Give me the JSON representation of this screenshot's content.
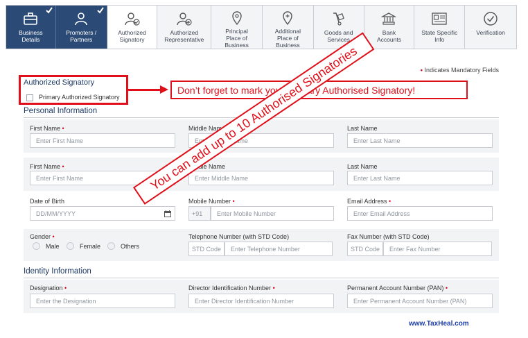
{
  "tabs": [
    {
      "label1": "Business",
      "label2": "Details",
      "icon": "briefcase-icon",
      "state": "done"
    },
    {
      "label1": "Promoters /",
      "label2": "Partners",
      "icon": "person-icon",
      "state": "done"
    },
    {
      "label1": "Authorized",
      "label2": "Signatory",
      "icon": "person-check-icon",
      "state": "active"
    },
    {
      "label1": "Authorized",
      "label2": "Representative",
      "icon": "person-plus-icon",
      "state": "todo"
    },
    {
      "label1": "Principal",
      "label2": "Place of",
      "label3": "Business",
      "icon": "location-pin-icon",
      "state": "todo"
    },
    {
      "label1": "Additional",
      "label2": "Place of",
      "label3": "Business",
      "icon": "location-plus-icon",
      "state": "todo"
    },
    {
      "label1": "Goods and",
      "label2": "Services",
      "icon": "hand-truck-icon",
      "state": "todo"
    },
    {
      "label1": "Bank",
      "label2": "Accounts",
      "icon": "bank-icon",
      "state": "todo"
    },
    {
      "label1": "State Specific",
      "label2": "Info",
      "icon": "id-card-icon",
      "state": "todo"
    },
    {
      "label1": "Verification",
      "label2": "",
      "icon": "check-circle-icon",
      "state": "todo"
    }
  ],
  "mandatory_note": "Indicates Mandatory Fields",
  "mandatory_star": "•",
  "authorized_signatory": {
    "title": "Authorized Signatory",
    "checkbox_label": "Primary Authorized Signatory"
  },
  "callout_text": "Don’t forget to mark your Primary Authorised Signatory!",
  "banner_text": "You can add up to 10 Authorised  Signatories",
  "personal_information": {
    "title": "Personal Information",
    "row1": {
      "first_label": "First Name",
      "first_placeholder": "Enter First Name",
      "middle_label": "Middle Name",
      "middle_placeholder": "Enter Middle Name",
      "last_label": "Last Name",
      "last_placeholder": "Enter Last Name"
    },
    "row2": {
      "first_label": "First Name",
      "first_placeholder": "Enter First Name",
      "middle_label": "Middle Name",
      "middle_placeholder": "Enter Middle Name",
      "last_label": "Last Name",
      "last_placeholder": "Enter Last Name"
    },
    "dob_label": "Date of Birth",
    "dob_placeholder": "DD/MM/YYYY",
    "mobile_label": "Mobile Number",
    "mobile_prefix": "+91",
    "mobile_placeholder": "Enter Mobile Number",
    "email_label": "Email Address",
    "email_placeholder": "Enter Email Address",
    "gender_label": "Gender",
    "gender_options": [
      "Male",
      "Female",
      "Others"
    ],
    "telephone_label": "Telephone Number (with STD Code)",
    "std_placeholder": "STD Code",
    "telephone_placeholder": "Enter Telephone Number",
    "fax_label": "Fax Number (with STD Code)",
    "fax_std_placeholder": "STD Code",
    "fax_placeholder": "Enter Fax Number"
  },
  "identity_information": {
    "title": "Identity Information",
    "designation_label": "Designation",
    "designation_placeholder": "Enter the Designation",
    "din_label": "Director Identification Number",
    "din_placeholder": "Enter Director Identification Number",
    "pan_label": "Permanent Account Number (PAN)",
    "pan_placeholder": "Enter Permanent Account Number (PAN)"
  },
  "required_star": "•",
  "watermark": "www.TaxHeal.com",
  "colors": {
    "done_tab": "#2c4a76",
    "accent_red": "#e0101a",
    "heading_blue": "#1e3a66"
  }
}
